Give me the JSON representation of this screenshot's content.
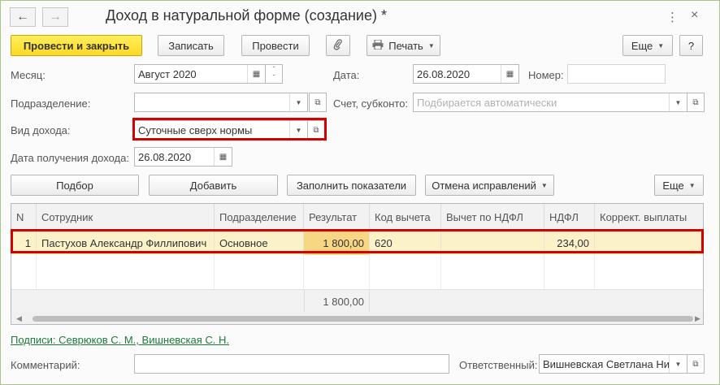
{
  "window": {
    "title": "Доход в натуральной форме (создание) *",
    "back_icon": "←",
    "forward_icon": "→",
    "more_icon": "⋮",
    "close_icon": "×"
  },
  "toolbar": {
    "post_close": "Провести и закрыть",
    "save": "Записать",
    "post": "Провести",
    "attach_icon": "📎",
    "print": "Печать",
    "more": "Еще",
    "help": "?"
  },
  "form": {
    "month_label": "Месяц:",
    "month_value": "Август 2020",
    "date_label": "Дата:",
    "date_value": "26.08.2020",
    "number_label": "Номер:",
    "number_value": "",
    "department_label": "Подразделение:",
    "department_value": "",
    "account_label": "Счет, субконто:",
    "account_placeholder": "Подбирается автоматически",
    "income_type_label": "Вид дохода:",
    "income_type_value": "Суточные сверх нормы",
    "income_date_label": "Дата получения дохода:",
    "income_date_value": "26.08.2020"
  },
  "table_toolbar": {
    "pick": "Подбор",
    "add": "Добавить",
    "fill": "Заполнить показатели",
    "cancel_fix": "Отмена исправлений",
    "more": "Еще"
  },
  "table": {
    "columns": [
      "N",
      "Сотрудник",
      "Подразделение",
      "Результат",
      "Код вычета",
      "Вычет по НДФЛ",
      "НДФЛ",
      "Коррект. выплаты"
    ],
    "rows": [
      {
        "n": "1",
        "employee": "Пастухов Александр Филлипович",
        "department": "Основное",
        "result": "1 800,00",
        "deduction_code": "620",
        "ndfl_deduction": "",
        "ndfl": "234,00",
        "correction": ""
      }
    ],
    "footer_result": "1 800,00"
  },
  "signatures_link": "Подписи: Севрюков С. М., Вишневская С. Н.",
  "bottom": {
    "comment_label": "Комментарий:",
    "comment_value": "",
    "responsible_label": "Ответственный:",
    "responsible_value": "Вишневская Светлана Ни"
  },
  "colors": {
    "accent_yellow": "#ffd826",
    "highlight_red": "#d40000",
    "row_highlight": "#fbf2c9",
    "link_green": "#1d7b3a"
  }
}
